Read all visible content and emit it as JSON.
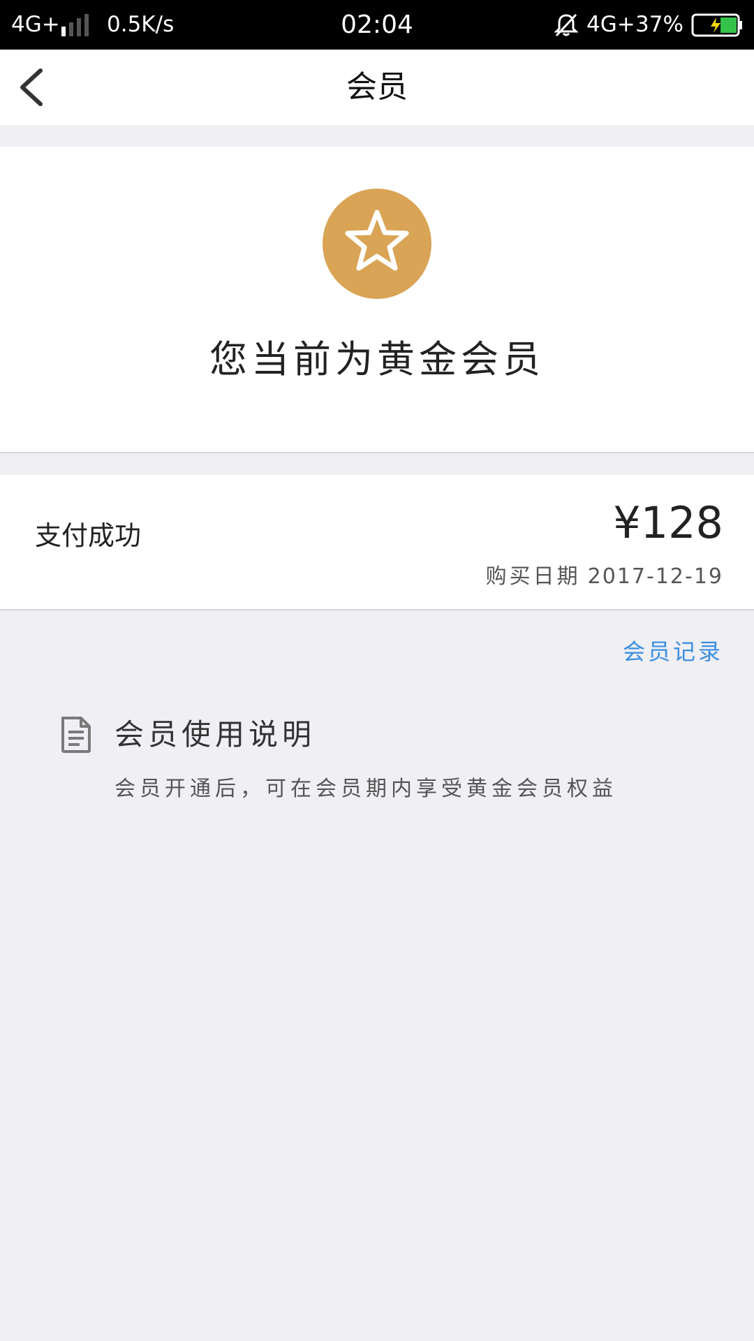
{
  "status_bar": {
    "network_left": "4G+",
    "speed": "0.5K/s",
    "time": "02:04",
    "network_right": "4G+",
    "battery": "37%",
    "icons": [
      "signal-icon",
      "mute-icon",
      "battery-icon"
    ]
  },
  "nav": {
    "title": "会员",
    "back_icon": "chevron-left-icon"
  },
  "member": {
    "status": "您当前为黄金会员",
    "badge_icon": "star-icon",
    "badge_color": "#d9a455"
  },
  "payment": {
    "label": "支付成功",
    "amount": "¥128",
    "date_label": "购买日期",
    "date": "2017-12-19"
  },
  "records_link": "会员记录",
  "usage": {
    "icon": "document-icon",
    "title": "会员使用说明",
    "description": "会员开通后，可在会员期内享受黄金会员权益"
  },
  "colors": {
    "background": "#efeff4",
    "link": "#3b8fe0"
  }
}
